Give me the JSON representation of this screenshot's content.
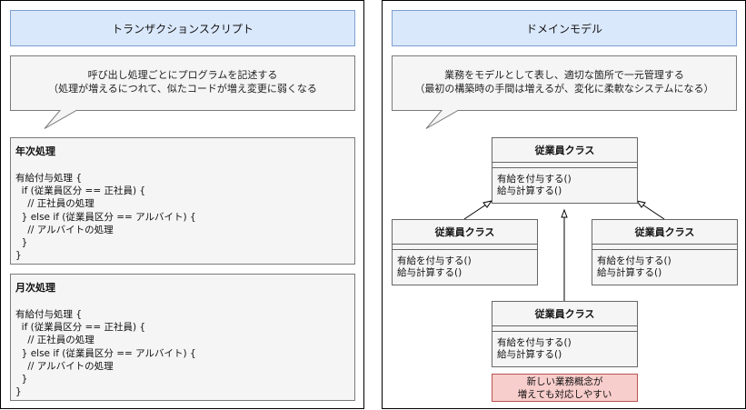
{
  "left": {
    "title": "トランザクションスクリプト",
    "callout_line1": "呼び出し処理ごとにプログラムを記述する",
    "callout_line2": "（処理が増えるにつれて、似たコードが増え変更に弱くなる",
    "boxes": [
      {
        "title": "年次処理",
        "lines": [
          "有給付与処理 {",
          "  if (従業員区分 == 正社員) {",
          "    // 正社員の処理",
          "  } else if (従業員区分 == アルバイト) {",
          "    // アルバイトの処理",
          "  }",
          "}"
        ]
      },
      {
        "title": "月次処理",
        "lines": [
          "有給付与処理 {",
          "  if (従業員区分 == 正社員) {",
          "    // 正社員の処理",
          "  } else if (従業員区分 == アルバイト) {",
          "    // アルバイトの処理",
          "  }",
          "}"
        ]
      }
    ]
  },
  "right": {
    "title": "ドメインモデル",
    "callout_line1": "業務をモデルとして表し、適切な箇所で一元管理する",
    "callout_line2": "（最初の構築時の手間は増えるが、変化に柔軟なシステムになる）",
    "classes": [
      {
        "name": "従業員クラス",
        "method1": "有給を付与する()",
        "method2": "給与計算する()"
      },
      {
        "name": "従業員クラス",
        "method1": "有給を付与する()",
        "method2": "給与計算する()"
      },
      {
        "name": "従業員クラス",
        "method1": "有給を付与する()",
        "method2": "給与計算する()"
      },
      {
        "name": "従業員クラス",
        "method1": "有給を付与する()",
        "method2": "給与計算する()"
      }
    ],
    "note_line1": "新しい業務概念が",
    "note_line2": "増えても対応しやすい",
    "note_color": "#f8cecc"
  }
}
